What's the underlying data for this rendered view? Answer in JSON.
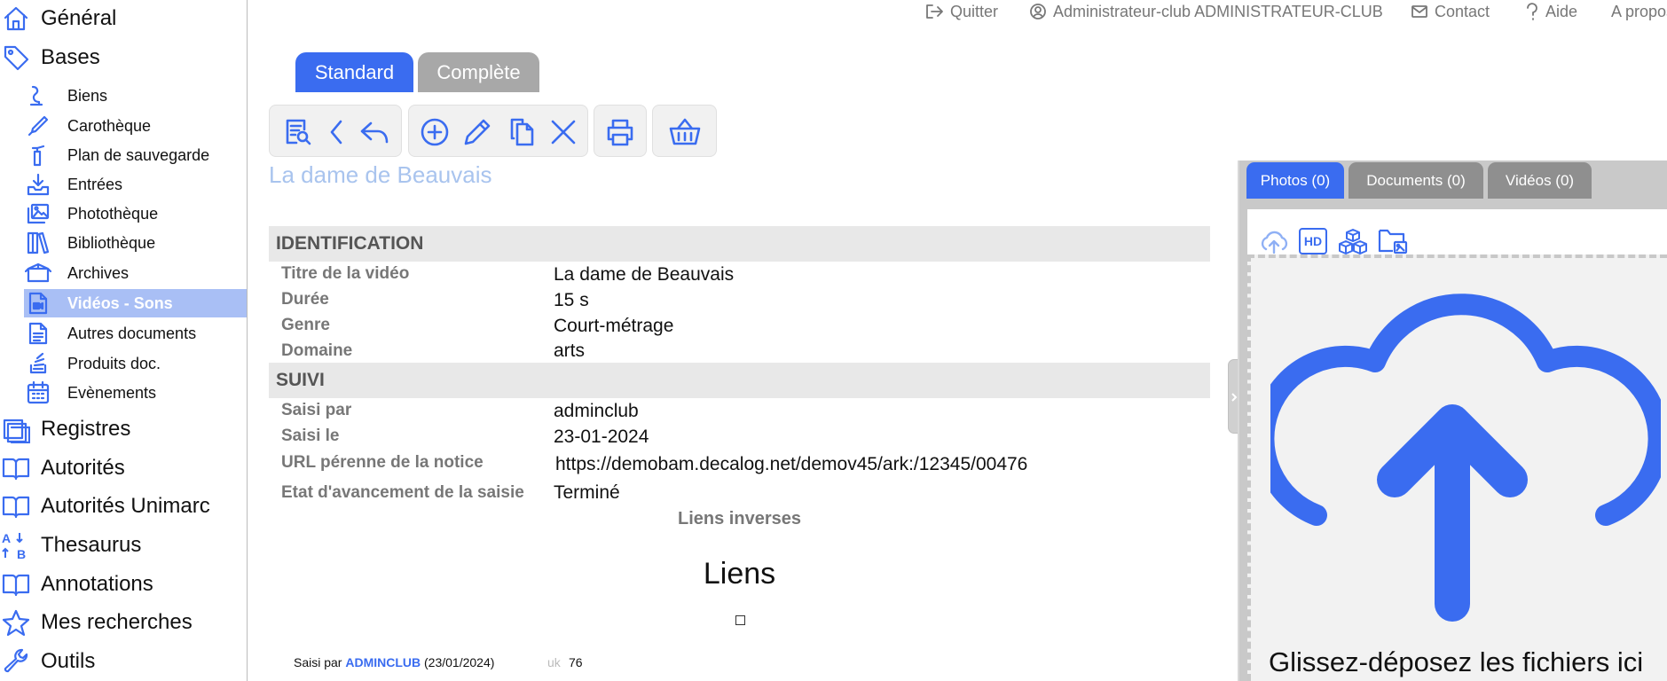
{
  "sidebar": {
    "top_items": [
      {
        "label": "Général",
        "icon": "home-icon"
      },
      {
        "label": "Bases",
        "icon": "tag-icon"
      }
    ],
    "sub_items": [
      {
        "label": "Biens",
        "icon": "objects-icon"
      },
      {
        "label": "Carothèque",
        "icon": "pen-icon"
      },
      {
        "label": "Plan de sauvegarde",
        "icon": "fire-extinguisher-icon"
      },
      {
        "label": "Entrées",
        "icon": "inbox-download-icon"
      },
      {
        "label": "Photothèque",
        "icon": "images-icon"
      },
      {
        "label": "Bibliothèque",
        "icon": "books-icon"
      },
      {
        "label": "Archives",
        "icon": "archive-box-icon"
      },
      {
        "label": "Vidéos - Sons",
        "icon": "video-file-icon",
        "active": true
      },
      {
        "label": "Autres documents",
        "icon": "document-icon"
      },
      {
        "label": "Produits doc.",
        "icon": "stack-icon"
      },
      {
        "label": "Evènements",
        "icon": "calendar-icon"
      }
    ],
    "bottom_items": [
      {
        "label": "Registres",
        "icon": "registers-icon"
      },
      {
        "label": "Autorités",
        "icon": "open-book-icon"
      },
      {
        "label": "Autorités Unimarc",
        "icon": "open-book-icon"
      },
      {
        "label": "Thesaurus",
        "icon": "sort-az-icon"
      },
      {
        "label": "Annotations",
        "icon": "open-book-icon"
      },
      {
        "label": "Mes recherches",
        "icon": "star-icon"
      },
      {
        "label": "Outils",
        "icon": "wrench-icon"
      }
    ]
  },
  "topnav": {
    "quit": "Quitter",
    "user": "Administrateur-club ADMINISTRATEUR-CLUB",
    "contact": "Contact",
    "help": "Aide",
    "about": "A propos"
  },
  "view_tabs": {
    "standard": "Standard",
    "complete": "Complète"
  },
  "colors": {
    "accent": "#3a6cf0",
    "tab_inactive": "#a8a8a8",
    "active_sidebar": "#a9bff5",
    "record_title": "#a9c4ee"
  },
  "record": {
    "title": "La dame de Beauvais",
    "sections": {
      "identification": "IDENTIFICATION",
      "suivi": "SUIVI"
    },
    "identification_fields": [
      {
        "label": "Titre de la vidéo",
        "value": "La dame de Beauvais"
      },
      {
        "label": "Durée",
        "value": "15 s"
      },
      {
        "label": "Genre",
        "value": "Court-métrage"
      },
      {
        "label": "Domaine",
        "value": "arts"
      }
    ],
    "suivi_fields": [
      {
        "label": "Saisi par",
        "value": "adminclub"
      },
      {
        "label": "Saisi le",
        "value": "23-01-2024"
      },
      {
        "label": "URL pérenne de la notice",
        "value": "https://demobam.decalog.net/demov45/ark:/12345/00476"
      },
      {
        "label": "Etat d'avancement de la saisie",
        "value": "Terminé"
      }
    ],
    "reverse_links": "Liens inverses",
    "links_heading": "Liens"
  },
  "footer": {
    "prefix": "Saisi par",
    "user": "ADMINCLUB",
    "date": "(23/01/2024)",
    "lang": "uk",
    "id": "76"
  },
  "media": {
    "tabs": {
      "photos": "Photos (0)",
      "documents": "Documents (0)",
      "videos": "Vidéos (0)"
    },
    "hd_label": "HD",
    "dropzone_text": "Glissez-déposez les fichiers ici"
  }
}
